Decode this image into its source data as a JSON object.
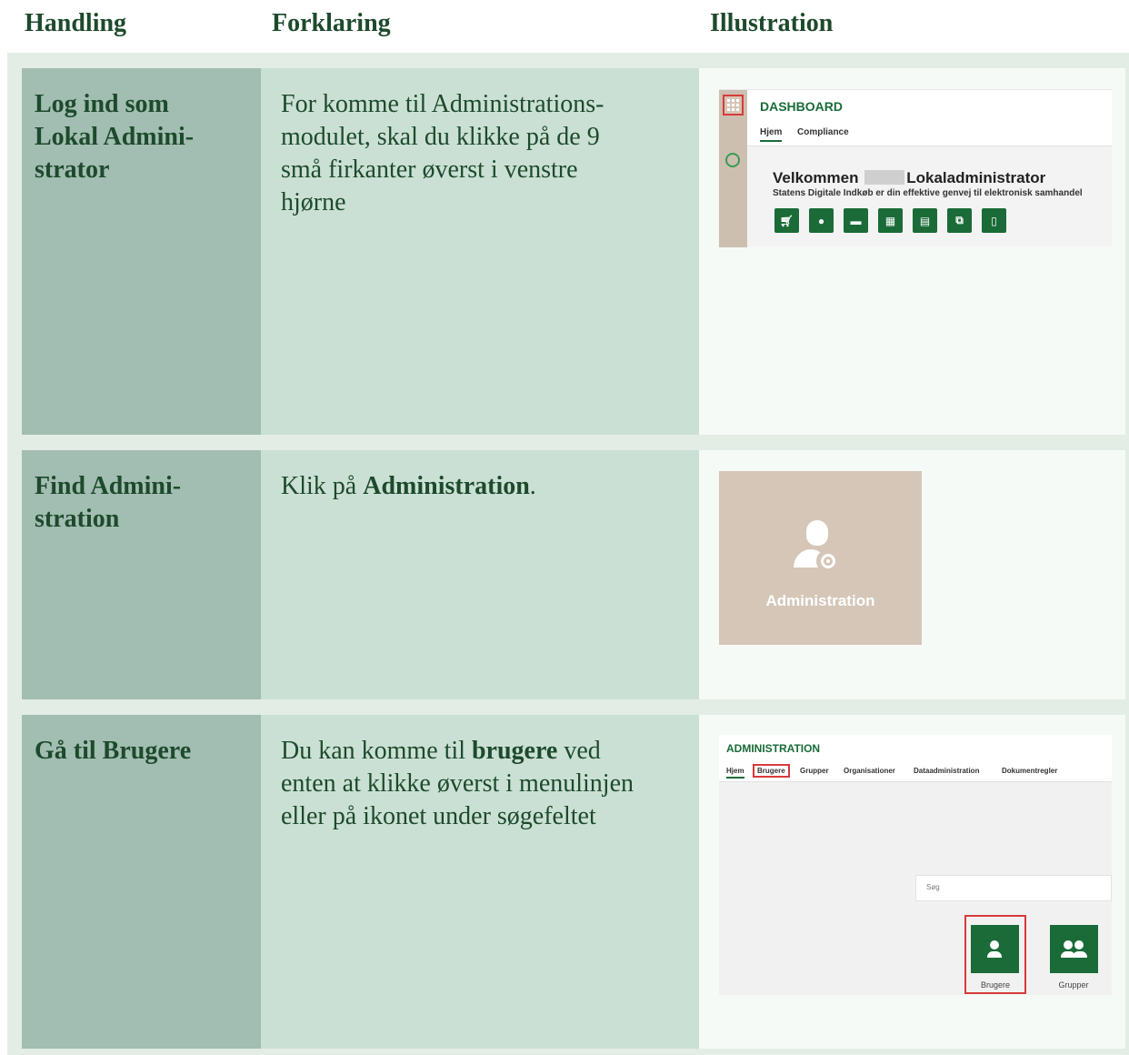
{
  "headers": {
    "handling": "Handling",
    "forklaring": "Forklaring",
    "illustration": "Illustration"
  },
  "rows": [
    {
      "handling": "Log ind som\nLokal Admini-\nstrator",
      "forklaring": "For komme til Administrations-\nmodulet, skal du klikke på de 9\nsmå firkanter øverst i venstre\nhjørne"
    },
    {
      "handling": "Find Admini-\nstration",
      "forklaring_pre": "Klik på ",
      "forklaring_bold": "Administration",
      "forklaring_post": "."
    },
    {
      "handling": "Gå til Brugere",
      "forklaring_pre": "Du kan komme til ",
      "forklaring_bold": "brugere",
      "forklaring_post": " ved\nenten at klikke øverst i menulinjen\neller på ikonet under søgefeltet"
    }
  ],
  "dashboard": {
    "title": "DASHBOARD",
    "tabs": [
      "Hjem",
      "Compliance"
    ],
    "welcome_pre": "Velkommen",
    "welcome_post": "Lokaladministrator",
    "subtitle": "Statens Digitale Indkøb er din effektive genvej til elektronisk samhandel",
    "icons": [
      "cart-icon",
      "user-icon",
      "handshake-icon",
      "excel-icon",
      "invoice-icon",
      "exchange-icon",
      "document-icon"
    ]
  },
  "admin_tile": {
    "label": "Administration"
  },
  "administration": {
    "title": "ADMINISTRATION",
    "tabs": [
      "Hjem",
      "Brugere",
      "Grupper",
      "Organisationer",
      "Dataadministration",
      "Dokumentregler"
    ],
    "search_placeholder": "Søg",
    "tiles": [
      "Brugere",
      "Grupper"
    ]
  },
  "colors": {
    "green": "#1a6b38",
    "highlight": "#d83a3a",
    "tan": "#d5c6b8"
  }
}
